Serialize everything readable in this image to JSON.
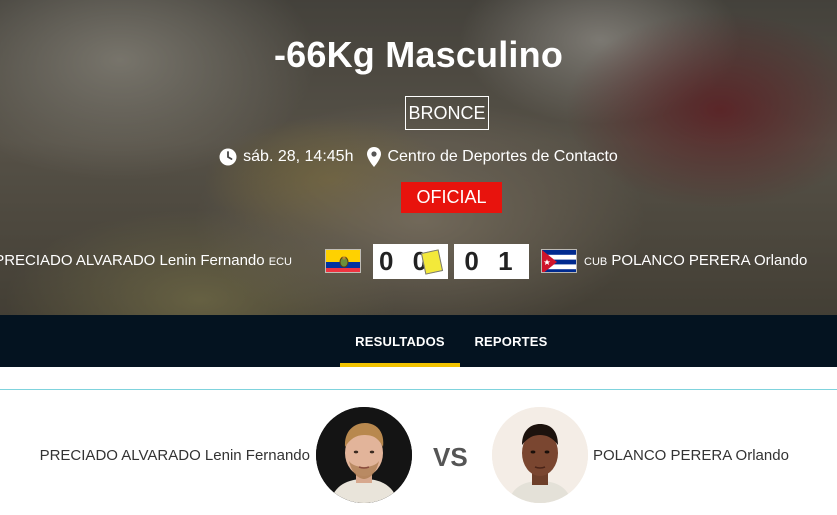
{
  "event": {
    "title": "-66Kg Masculino",
    "round": "BRONCE",
    "datetime": "sáb. 28, 14:45h",
    "venue": "Centro de Deportes de Contacto",
    "status": "OFICIAL"
  },
  "match": {
    "left": {
      "name": "PRECIADO ALVARADO Lenin Fernando",
      "country_code": "ECU",
      "score": "0 0",
      "penalty_card": "yellow"
    },
    "right": {
      "name": "POLANCO PERERA Orlando",
      "country_code": "CUB",
      "score": "0 1"
    }
  },
  "nav": {
    "tabs": [
      {
        "label": "RESULTADOS",
        "active": true
      },
      {
        "label": "REPORTES",
        "active": false
      }
    ]
  },
  "versus": {
    "left_name": "PRECIADO ALVARADO Lenin Fernando",
    "right_name": "POLANCO PERERA Orlando",
    "vs_label": "VS"
  },
  "colors": {
    "accent": "#f2c200",
    "status": "#e8130d",
    "nav_bg": "#041320",
    "divider": "#7fd3dd"
  },
  "icons": [
    "clock-icon",
    "location-pin-icon",
    "ecuador-flag-icon",
    "cuba-flag-icon",
    "yellow-card-icon"
  ]
}
